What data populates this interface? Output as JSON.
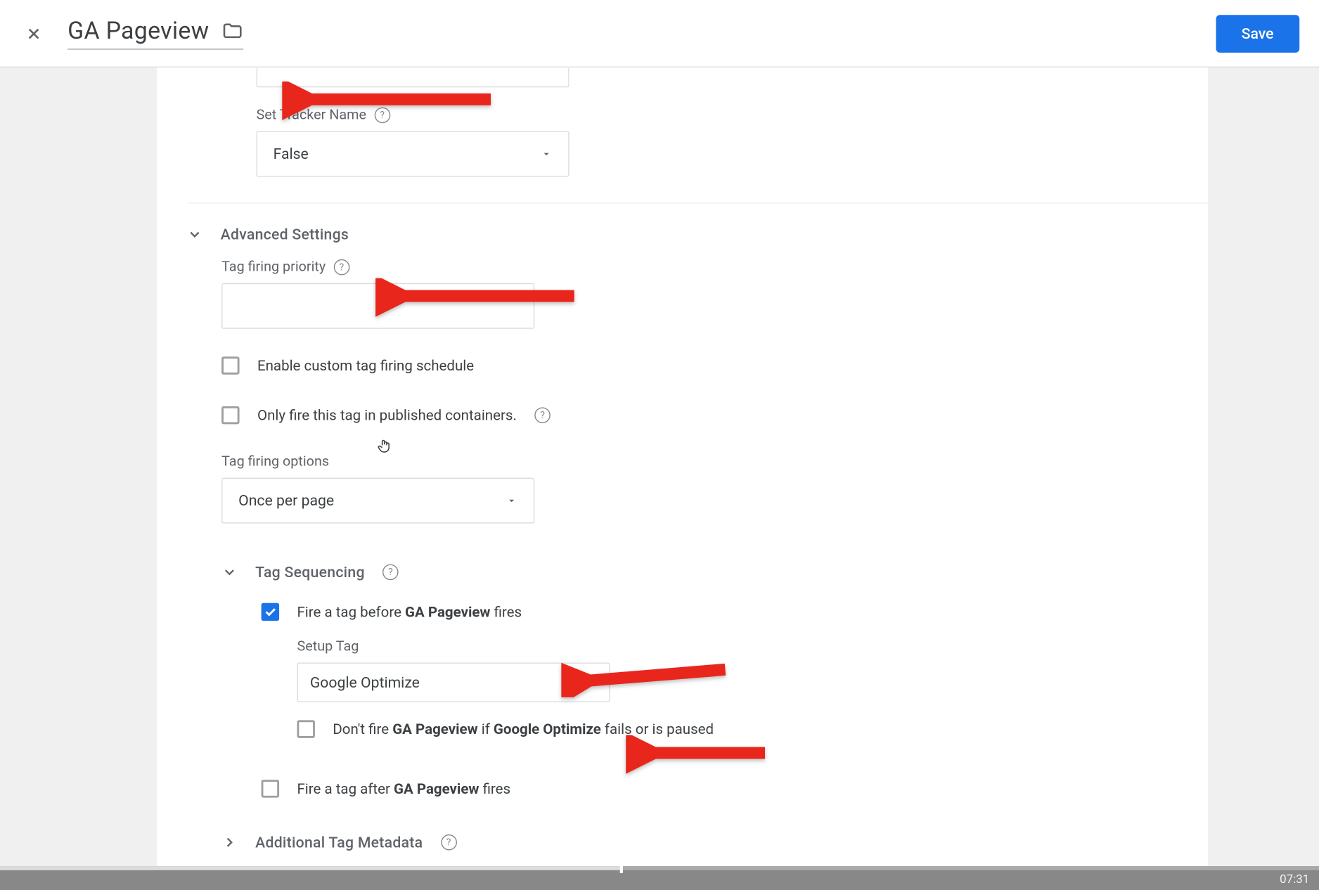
{
  "header": {
    "title": "GA Pageview",
    "save_label": "Save"
  },
  "tracker": {
    "label": "Set Tracker Name",
    "value": "False"
  },
  "advanced": {
    "title": "Advanced Settings",
    "priority_label": "Tag firing priority",
    "enable_schedule": "Enable custom tag firing schedule",
    "only_published": "Only fire this tag in published containers.",
    "firing_options_label": "Tag firing options",
    "firing_options_value": "Once per page"
  },
  "sequencing": {
    "title": "Tag Sequencing",
    "fire_before_prefix": "Fire a tag before ",
    "tag_name": "GA Pageview",
    "fire_before_suffix": " fires",
    "setup_tag_label": "Setup Tag",
    "setup_tag_value": "Google Optimize",
    "dont_fire_prefix": "Don't fire ",
    "dont_fire_mid": " if ",
    "dont_fire_tag2": "Google Optimize",
    "dont_fire_suffix": " fails or is paused",
    "fire_after_prefix": "Fire a tag after ",
    "fire_after_suffix": " fires"
  },
  "metadata": {
    "title": "Additional Tag Metadata"
  },
  "video": {
    "time": "07:31"
  }
}
